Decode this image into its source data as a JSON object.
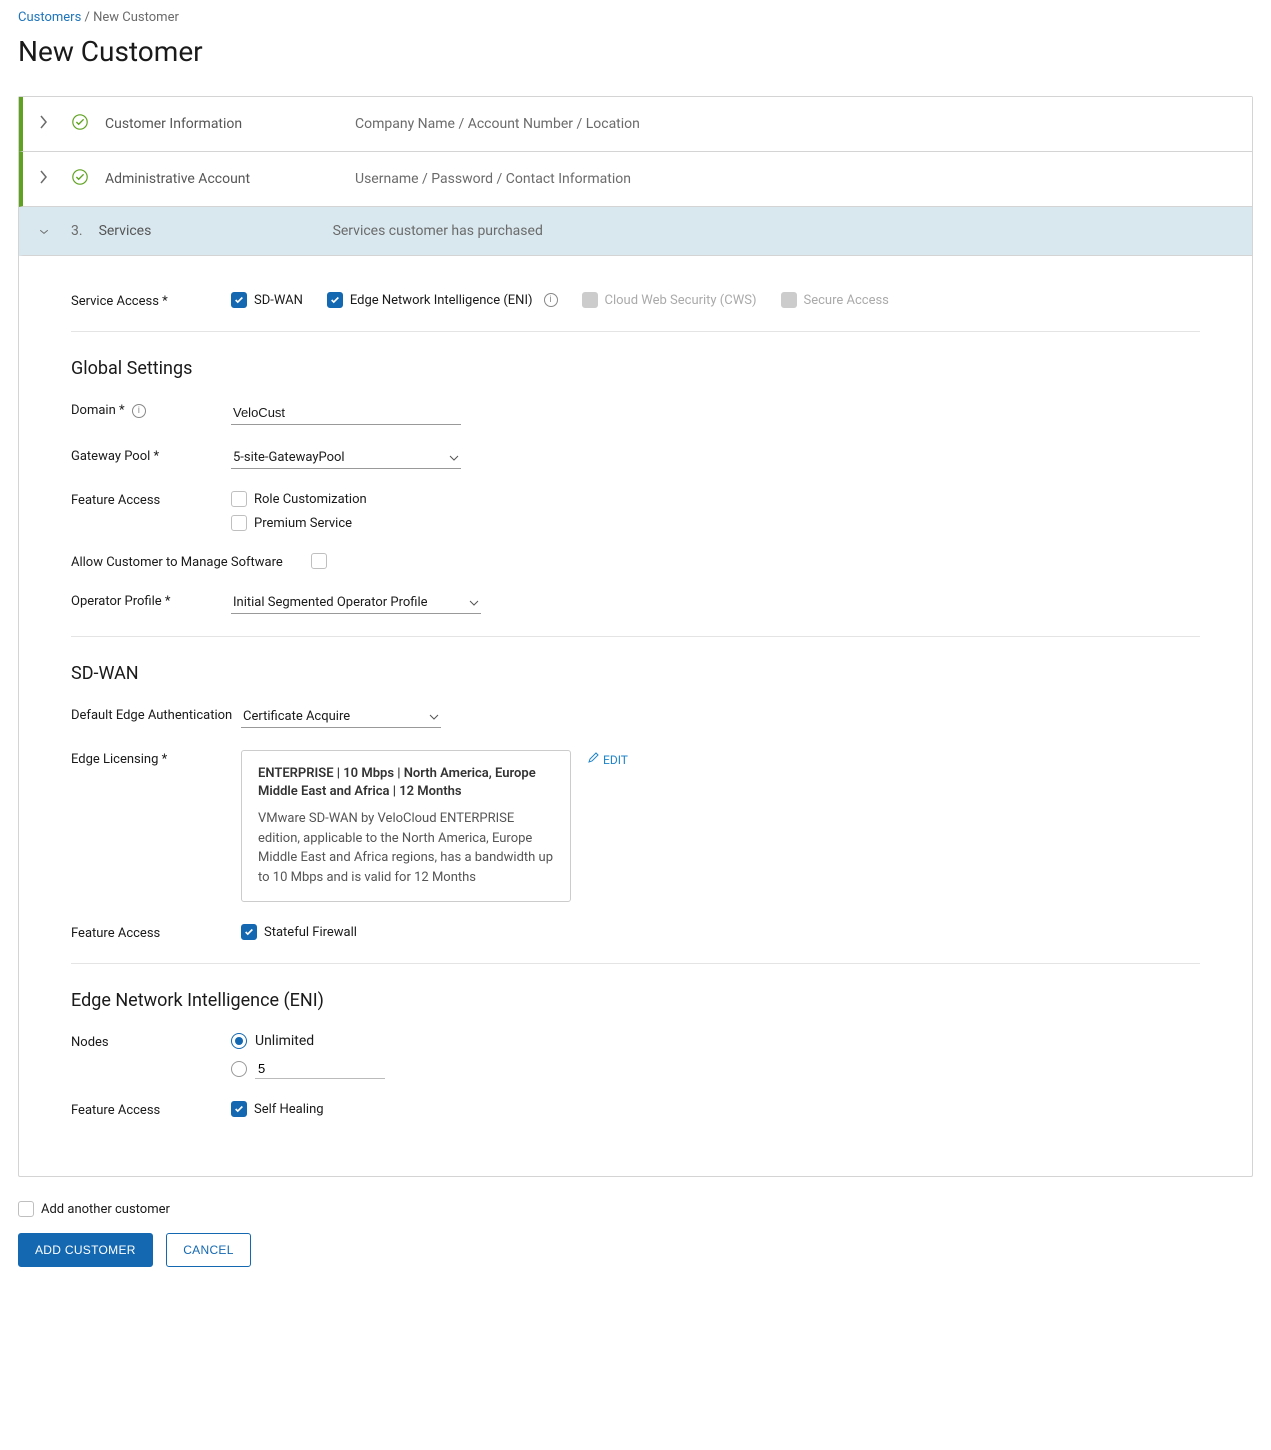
{
  "breadcrumb": {
    "parent": "Customers",
    "sep": " / ",
    "current": "New Customer"
  },
  "page": {
    "title": "New Customer"
  },
  "steps": {
    "s1": {
      "label": "Customer Information",
      "desc": "Company Name / Account Number / Location"
    },
    "s2": {
      "label": "Administrative Account",
      "desc": "Username / Password / Contact Information"
    },
    "s3": {
      "num": "3.",
      "label": "Services",
      "desc": "Services customer has purchased"
    }
  },
  "serviceAccess": {
    "label": "Service Access",
    "opts": {
      "sdwan": "SD-WAN",
      "eni": "Edge Network Intelligence (ENI)",
      "cws": "Cloud Web Security (CWS)",
      "secure": "Secure Access"
    }
  },
  "global": {
    "heading": "Global Settings",
    "domain": {
      "label": "Domain",
      "value": "VeloCust"
    },
    "gateway": {
      "label": "Gateway Pool",
      "value": "5-site-GatewayPool"
    },
    "feature": {
      "label": "Feature Access",
      "role": "Role Customization",
      "premium": "Premium Service"
    },
    "manage": {
      "label": "Allow Customer to Manage Software"
    },
    "operator": {
      "label": "Operator Profile",
      "value": "Initial Segmented Operator Profile"
    }
  },
  "sdwan": {
    "heading": "SD-WAN",
    "auth": {
      "label": "Default Edge Authentication",
      "value": "Certificate Acquire"
    },
    "licensing": {
      "label": "Edge Licensing",
      "title": "ENTERPRISE | 10 Mbps | North America, Europe Middle East and Africa | 12 Months",
      "desc": "VMware SD-WAN by VeloCloud ENTERPRISE edition, applicable to the North America, Europe Middle East and Africa regions, has a bandwidth up to 10 Mbps and is valid for 12 Months",
      "edit": "EDIT"
    },
    "feature": {
      "label": "Feature Access",
      "stateful": "Stateful Firewall"
    }
  },
  "eni": {
    "heading": "Edge Network Intelligence (ENI)",
    "nodes": {
      "label": "Nodes",
      "unlimited": "Unlimited",
      "custom": "5"
    },
    "feature": {
      "label": "Feature Access",
      "selfheal": "Self Healing"
    }
  },
  "footer": {
    "addAnother": "Add another customer",
    "add": "ADD CUSTOMER",
    "cancel": "CANCEL"
  }
}
